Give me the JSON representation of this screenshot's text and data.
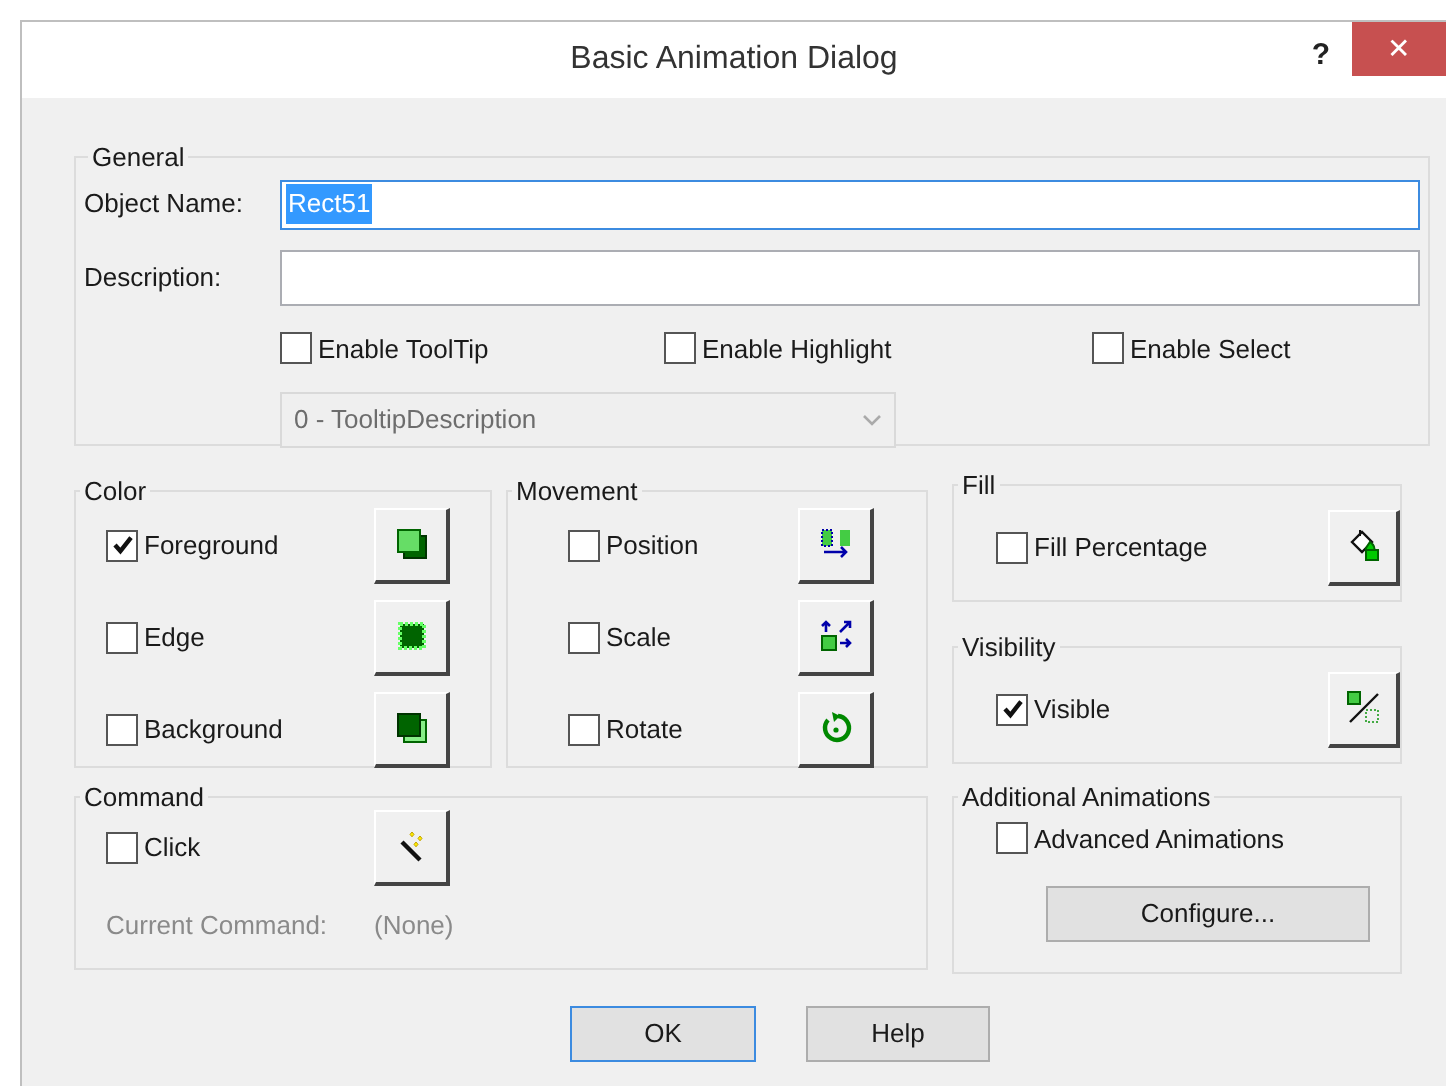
{
  "window": {
    "title": "Basic Animation Dialog",
    "help": "?",
    "close": "✕"
  },
  "general": {
    "legend": "General",
    "object_name": {
      "label": "Object Name:",
      "value": "Rect51",
      "focused": true
    },
    "description": {
      "label": "Description:"
    },
    "options": [
      {
        "label": "Enable ToolTip",
        "checked": false
      },
      {
        "label": "Enable Highlight",
        "checked": false
      },
      {
        "label": "Enable Select",
        "checked": false
      }
    ],
    "tooltip_dropdown": {
      "value": "0 - TooltipDescription",
      "disabled": true
    }
  },
  "color": {
    "legend": "Color",
    "rows": [
      {
        "kind": "foreground",
        "label": "Foreground",
        "checked": true
      },
      {
        "kind": "edge",
        "label": "Edge",
        "checked": false
      },
      {
        "kind": "background",
        "label": "Background",
        "checked": false
      }
    ]
  },
  "movement": {
    "legend": "Movement",
    "rows": [
      {
        "kind": "position",
        "label": "Position",
        "checked": false
      },
      {
        "kind": "scale",
        "label": "Scale",
        "checked": false
      },
      {
        "kind": "rotate",
        "label": "Rotate",
        "checked": false
      }
    ]
  },
  "command": {
    "legend": "Command",
    "label": "Click",
    "checked": false,
    "current_label": "Current Command:",
    "current_value": "(None)",
    "disabled": true
  },
  "fill": {
    "legend": "Fill",
    "kind": "fill",
    "label": "Fill Percentage",
    "checked": false
  },
  "visibility": {
    "legend": "Visibility",
    "kind": "visibility",
    "label": "Visible",
    "checked": true
  },
  "additional": {
    "legend": "Additional Animations",
    "label": "Advanced Animations",
    "checked": false,
    "button": "Configure..."
  },
  "buttons": [
    {
      "label": "OK",
      "default": true
    },
    {
      "label": "Help",
      "default": false
    }
  ]
}
